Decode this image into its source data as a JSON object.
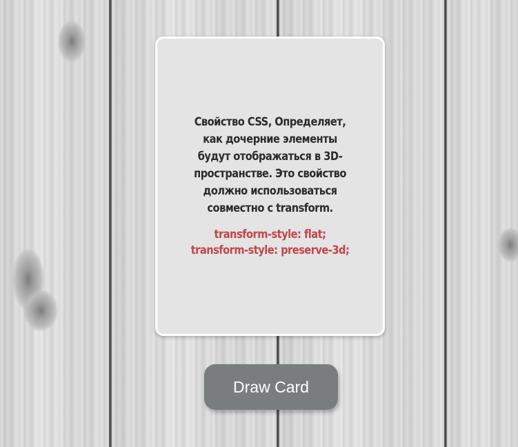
{
  "card": {
    "description": "Свойство CSS, Определяет, как дочерние элементы будут отображаться в 3D-пространстве. Это свойство должно использоваться совместно с transform.",
    "code": "transform-style: flat; transform-style: preserve-3d;"
  },
  "controls": {
    "draw_button_label": "Draw Card"
  },
  "colors": {
    "card_background": "#e4e4e4",
    "description_text": "#2b2b2b",
    "code_text": "#c2454a",
    "button_background": "#797d7e"
  }
}
